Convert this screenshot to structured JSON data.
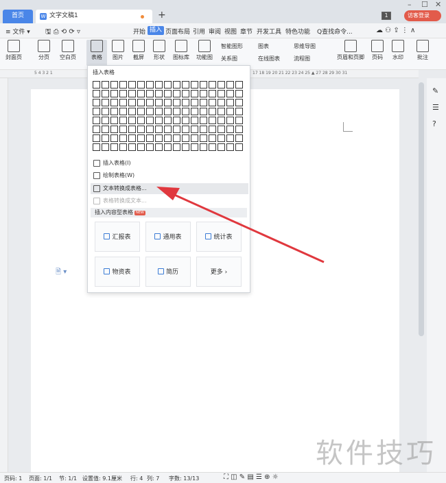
{
  "titlebar": {
    "home_tab": "首页",
    "doc_tab": "文字文稿1",
    "new_tab_icon": "plus-icon",
    "page_count_badge": "1",
    "visitor_login": "访客登录",
    "window_controls": [
      "–",
      "☐",
      "✕"
    ]
  },
  "menubar": {
    "file": "≡ 文件 ▾",
    "tabs": [
      "开始",
      "插入",
      "页面布局",
      "引用",
      "审阅",
      "视图",
      "章节",
      "开发工具",
      "特色功能"
    ],
    "active_tab": "插入",
    "search": "Q查找命令..."
  },
  "ribbon": {
    "items": [
      "封面页",
      "分页",
      "空白页",
      "表格",
      "图片",
      "截屏",
      "形状",
      "图标库",
      "功能图",
      "智能图形",
      "图表",
      "思维导图",
      "关系图",
      "在线图表",
      "流程图",
      "页眉和页脚",
      "页码",
      "水印",
      "批注"
    ]
  },
  "ruler": {
    "left_marks": "5 4 3 2 1",
    "right_marks": "17 18 19 20 21 22 23 24 25 ▲ 27 28 29 30 31"
  },
  "dropdown": {
    "title": "插入表格",
    "grid_cols": 17,
    "grid_rows": 8,
    "items": [
      {
        "label": "插入表格(I)",
        "state": "normal"
      },
      {
        "label": "绘制表格(W)",
        "state": "normal"
      },
      {
        "label": "文本转换成表格...",
        "state": "highlighted"
      },
      {
        "label": "表格转换成文本...",
        "state": "disabled"
      }
    ],
    "section_label": "插入内容型表格",
    "new_badge": "NEW",
    "cards": [
      "汇报表",
      "通用表",
      "统计表",
      "物资表",
      "简历",
      "更多 ›"
    ]
  },
  "statusbar": {
    "page": "页码: 1",
    "pages": "页面: 1/1",
    "section": "节: 1/1",
    "setting": "设置值: 9.1厘米",
    "row": "行: 4",
    "col": "列: 7",
    "words": "字数: 13/13"
  },
  "watermark": "软件技巧",
  "colors": {
    "accent": "#4a86e8",
    "arrow": "#e0383e",
    "visitor": "#e25b4b"
  }
}
